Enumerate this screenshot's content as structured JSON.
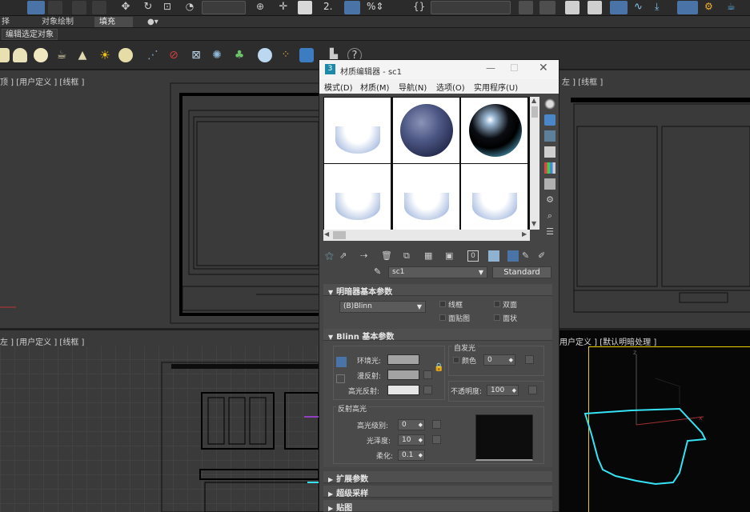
{
  "toolbar": {
    "selection_dropdown": "",
    "filter_dropdown": "",
    "tabs": [
      "择",
      "对象绘制",
      "填充"
    ],
    "active_tab": "填充",
    "edit_selected_label": "编辑选定对象"
  },
  "viewports": {
    "top_left_label": "顶 ] [用户定义 ] [线框 ]",
    "top_right_label": "左 ] [线框 ]",
    "bottom_left_label": "左 ] [用户定义 ] [线框 ]",
    "bottom_right_label": "用户定义 ] [默认明暗处理 ]"
  },
  "material_editor": {
    "title": "材质编辑器 - sc1",
    "menu": [
      "模式(D)",
      "材质(M)",
      "导航(N)",
      "选项(O)",
      "实用程序(U)"
    ],
    "material_name": "sc1",
    "material_type": "Standard",
    "shader_rollout": {
      "title": "明暗器基本参数",
      "shader": "(B)Blinn",
      "options": [
        "线框",
        "双面",
        "面贴图",
        "面状"
      ]
    },
    "blinn_rollout": {
      "title": "Blinn 基本参数",
      "ambient_label": "环境光:",
      "diffuse_label": "漫反射:",
      "specular_label": "高光反射:",
      "self_illum_group": "自发光",
      "color_label": "颜色",
      "self_illum_value": "0",
      "opacity_label": "不透明度:",
      "opacity_value": "100",
      "highlights_group": "反射高光",
      "spec_level_label": "高光级别:",
      "spec_level_value": "0",
      "glossiness_label": "光泽度:",
      "glossiness_value": "10",
      "soften_label": "柔化:",
      "soften_value": "0.1"
    },
    "collapsed_rollouts": [
      "扩展参数",
      "超级采样",
      "贴图"
    ]
  },
  "colors": {
    "viewport_bg": "#3a3a3a",
    "active_viewport_border": "#f0d000",
    "selection_cyan": "#35e3f5"
  }
}
